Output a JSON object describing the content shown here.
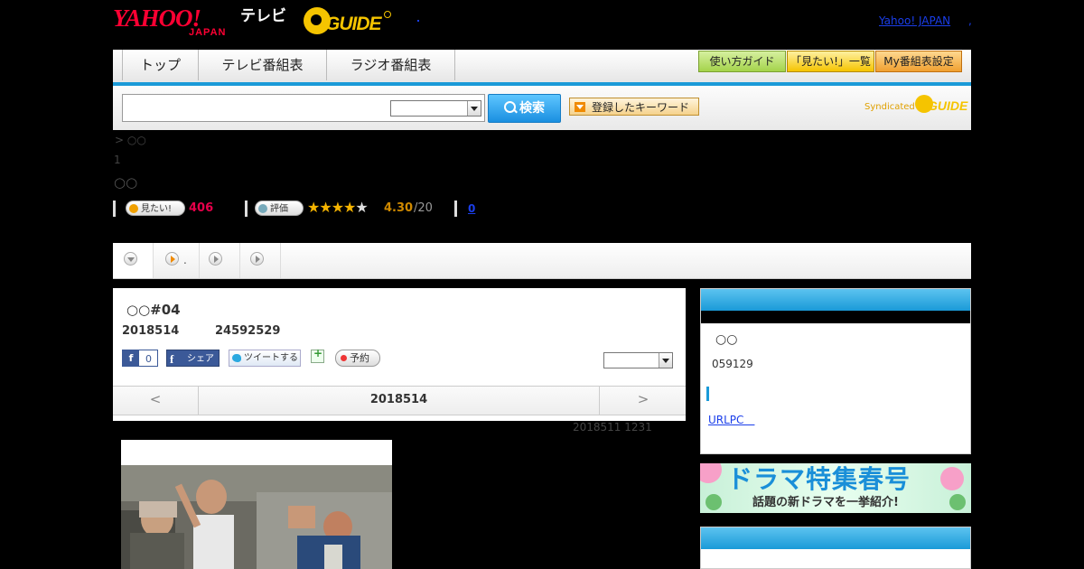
{
  "header": {
    "logo_yahoo": "YAHOO!",
    "logo_yahoo_sub": "JAPAN",
    "logo_tv": "テレビ",
    "logo_gguide": "GUIDE",
    "yahoo_japan_link": "Yahoo! JAPAN",
    "comma": ","
  },
  "nav": {
    "tabs": [
      {
        "label": "トップ"
      },
      {
        "label": "テレビ番組表"
      },
      {
        "label": "ラジオ番組表"
      }
    ],
    "buttons": [
      {
        "label": "使い方ガイド",
        "color": "#a4d34a"
      },
      {
        "label": "「見たい!」一覧",
        "color": "#f5c400"
      },
      {
        "label": "My番組表設定",
        "color": "#f0a030"
      }
    ]
  },
  "search": {
    "value": "",
    "select_value": "",
    "button_label": "検索",
    "keyword_button_label": "登録したキーワード",
    "syndicated_label": "Syndicated",
    "syndicated_logo": "GUIDE"
  },
  "program": {
    "breadcrumb": "> ○○",
    "episode_count": "1",
    "title": "○○",
    "watch_button": "見たい!",
    "watch_count": "406",
    "rate_button": "評価",
    "rating_value": "4.30",
    "rating_count": "/20",
    "comment_link": "0",
    "stars_filled": 4,
    "stars_total": 5
  },
  "tabs_row": {
    "tab2_label": "."
  },
  "episode": {
    "title": "○○#04",
    "date": "2018514",
    "time": "24592529",
    "fb_like_count": "0",
    "fb_like_icon": "f",
    "fb_share_label": "シェア",
    "tweet_label": "ツイートする",
    "reserve_label": "予約",
    "select_value": "",
    "nav_prev": "<",
    "nav_date": "2018514",
    "nav_next": ">",
    "updated": "2018511  1231"
  },
  "sidebar": {
    "genre": "○○",
    "time": "059129",
    "link": "URLPC　"
  },
  "banner": {
    "title": "ドラマ特集春号",
    "subtitle": "話題の新ドラマを一挙紹介!"
  },
  "colors": {
    "accent_blue": "#1a9ad8",
    "yahoo_red": "#ff0033",
    "gguide_yellow": "#f5c400",
    "watch_pink": "#e6004a",
    "star": "#f5b400"
  }
}
